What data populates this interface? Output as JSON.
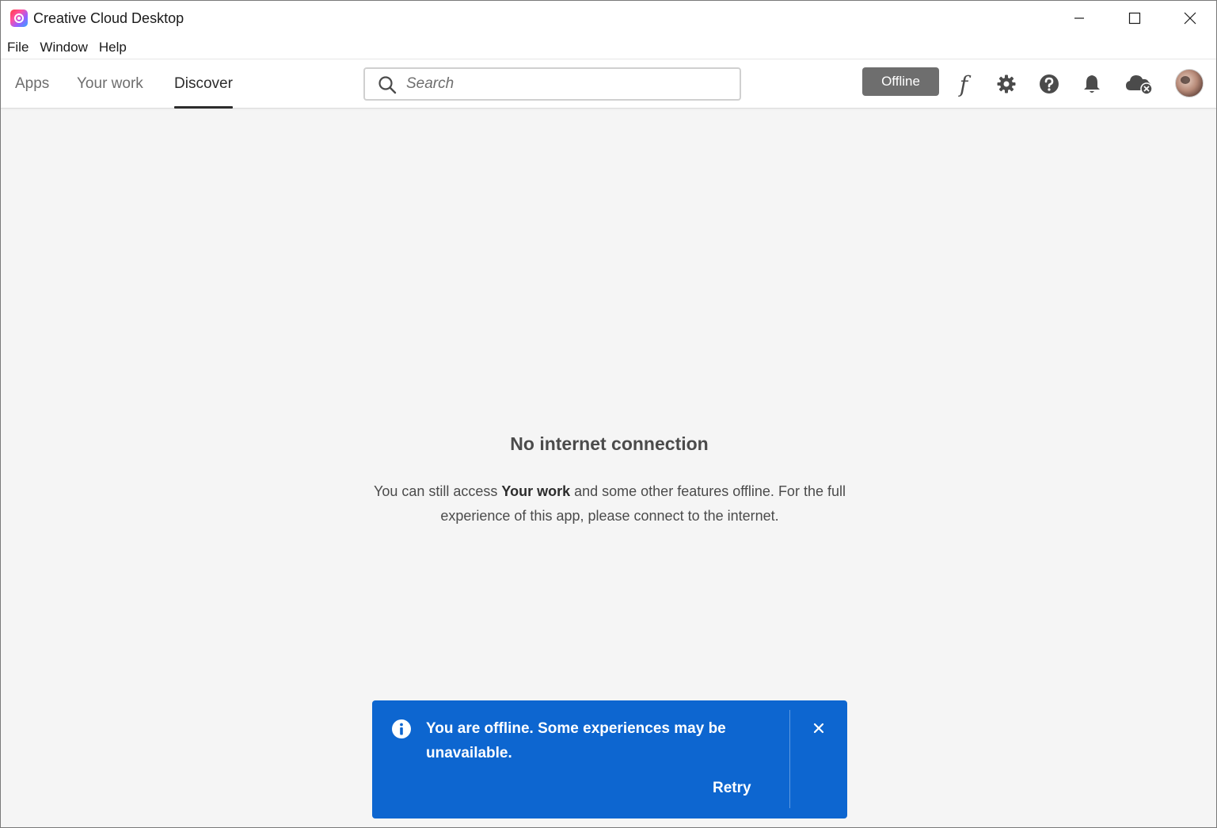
{
  "window": {
    "title": "Creative Cloud Desktop",
    "controls": [
      "minimize",
      "maximize",
      "close"
    ]
  },
  "menu": {
    "items": [
      "File",
      "Window",
      "Help"
    ]
  },
  "header": {
    "tabs": [
      {
        "label": "Apps",
        "active": false
      },
      {
        "label": "Your work",
        "active": false
      },
      {
        "label": "Discover",
        "active": true
      }
    ],
    "search": {
      "placeholder": "Search",
      "value": ""
    },
    "status_button": "Offline",
    "icons": [
      "fonts-icon",
      "gear-icon",
      "help-icon",
      "bell-icon",
      "cloud-offline-icon",
      "avatar"
    ]
  },
  "main": {
    "title": "No internet connection",
    "body_before": "You can still access ",
    "body_bold": "Your work",
    "body_after": " and some other features offline. For the full experience of this app, please connect to the internet."
  },
  "toast": {
    "message": "You are offline. Some experiences may be unavailable.",
    "action": "Retry",
    "color": "#0d66d0"
  },
  "colors": {
    "toast_bg": "#0d66d0",
    "offline_badge": "#6e6e6e",
    "content_bg": "#f5f5f5"
  }
}
